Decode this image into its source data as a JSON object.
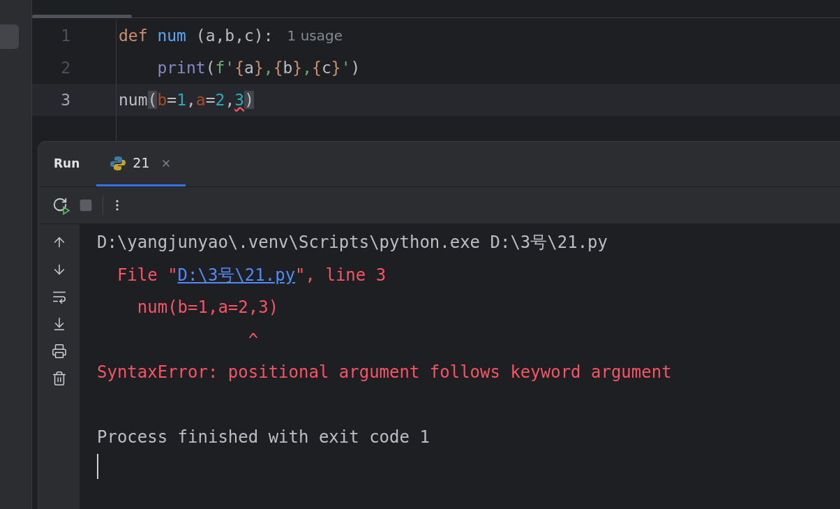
{
  "editor": {
    "lines": [
      {
        "number": "1",
        "current": false,
        "tokens": [
          {
            "kind": "keyword",
            "text": "def "
          },
          {
            "kind": "function",
            "text": "num"
          },
          {
            "kind": "plain",
            "text": " (a,b,c):"
          }
        ],
        "hint": "1 usage"
      },
      {
        "number": "2",
        "current": false,
        "tokens": [
          {
            "kind": "indent"
          },
          {
            "kind": "builtin",
            "text": "print"
          },
          {
            "kind": "plain",
            "text": "("
          },
          {
            "kind": "string",
            "text": "f'"
          },
          {
            "kind": "brace",
            "text": "{"
          },
          {
            "kind": "plain",
            "text": "a"
          },
          {
            "kind": "brace",
            "text": "}"
          },
          {
            "kind": "string",
            "text": ","
          },
          {
            "kind": "brace",
            "text": "{"
          },
          {
            "kind": "plain",
            "text": "b"
          },
          {
            "kind": "brace",
            "text": "}"
          },
          {
            "kind": "string",
            "text": ","
          },
          {
            "kind": "brace",
            "text": "{"
          },
          {
            "kind": "plain",
            "text": "c"
          },
          {
            "kind": "brace",
            "text": "}"
          },
          {
            "kind": "string",
            "text": "'"
          },
          {
            "kind": "plain",
            "text": ")"
          }
        ]
      },
      {
        "number": "3",
        "current": true,
        "tokens": [
          {
            "kind": "plain",
            "text": "num"
          },
          {
            "kind": "matched",
            "text": "("
          },
          {
            "kind": "param",
            "text": "b"
          },
          {
            "kind": "plain",
            "text": "="
          },
          {
            "kind": "number",
            "text": "1"
          },
          {
            "kind": "plain",
            "text": ","
          },
          {
            "kind": "param",
            "text": "a"
          },
          {
            "kind": "plain",
            "text": "="
          },
          {
            "kind": "number",
            "text": "2"
          },
          {
            "kind": "plain",
            "text": ","
          },
          {
            "kind": "error",
            "text": "3"
          },
          {
            "kind": "matched",
            "text": ")"
          }
        ]
      }
    ]
  },
  "run_panel": {
    "title": "Run",
    "tabs": [
      {
        "label": "21",
        "selected": true
      }
    ],
    "console": [
      {
        "kind": "normal",
        "parts": [
          {
            "text": "D:\\yangjunyao\\.venv\\Scripts\\python.exe D:\\3号\\21.py"
          }
        ]
      },
      {
        "kind": "error",
        "parts": [
          {
            "text": "  File \""
          },
          {
            "text": "D:\\3号\\21.py",
            "link": true
          },
          {
            "text": "\", line 3"
          }
        ]
      },
      {
        "kind": "error",
        "parts": [
          {
            "text": "    num(b=1,a=2,3)"
          }
        ]
      },
      {
        "kind": "error",
        "parts": [
          {
            "text": "               ^"
          }
        ]
      },
      {
        "kind": "error",
        "parts": [
          {
            "text": "SyntaxError: positional argument follows keyword argument"
          }
        ]
      },
      {
        "kind": "blank"
      },
      {
        "kind": "normal",
        "parts": [
          {
            "text": "Process finished with exit code 1"
          }
        ]
      }
    ]
  }
}
